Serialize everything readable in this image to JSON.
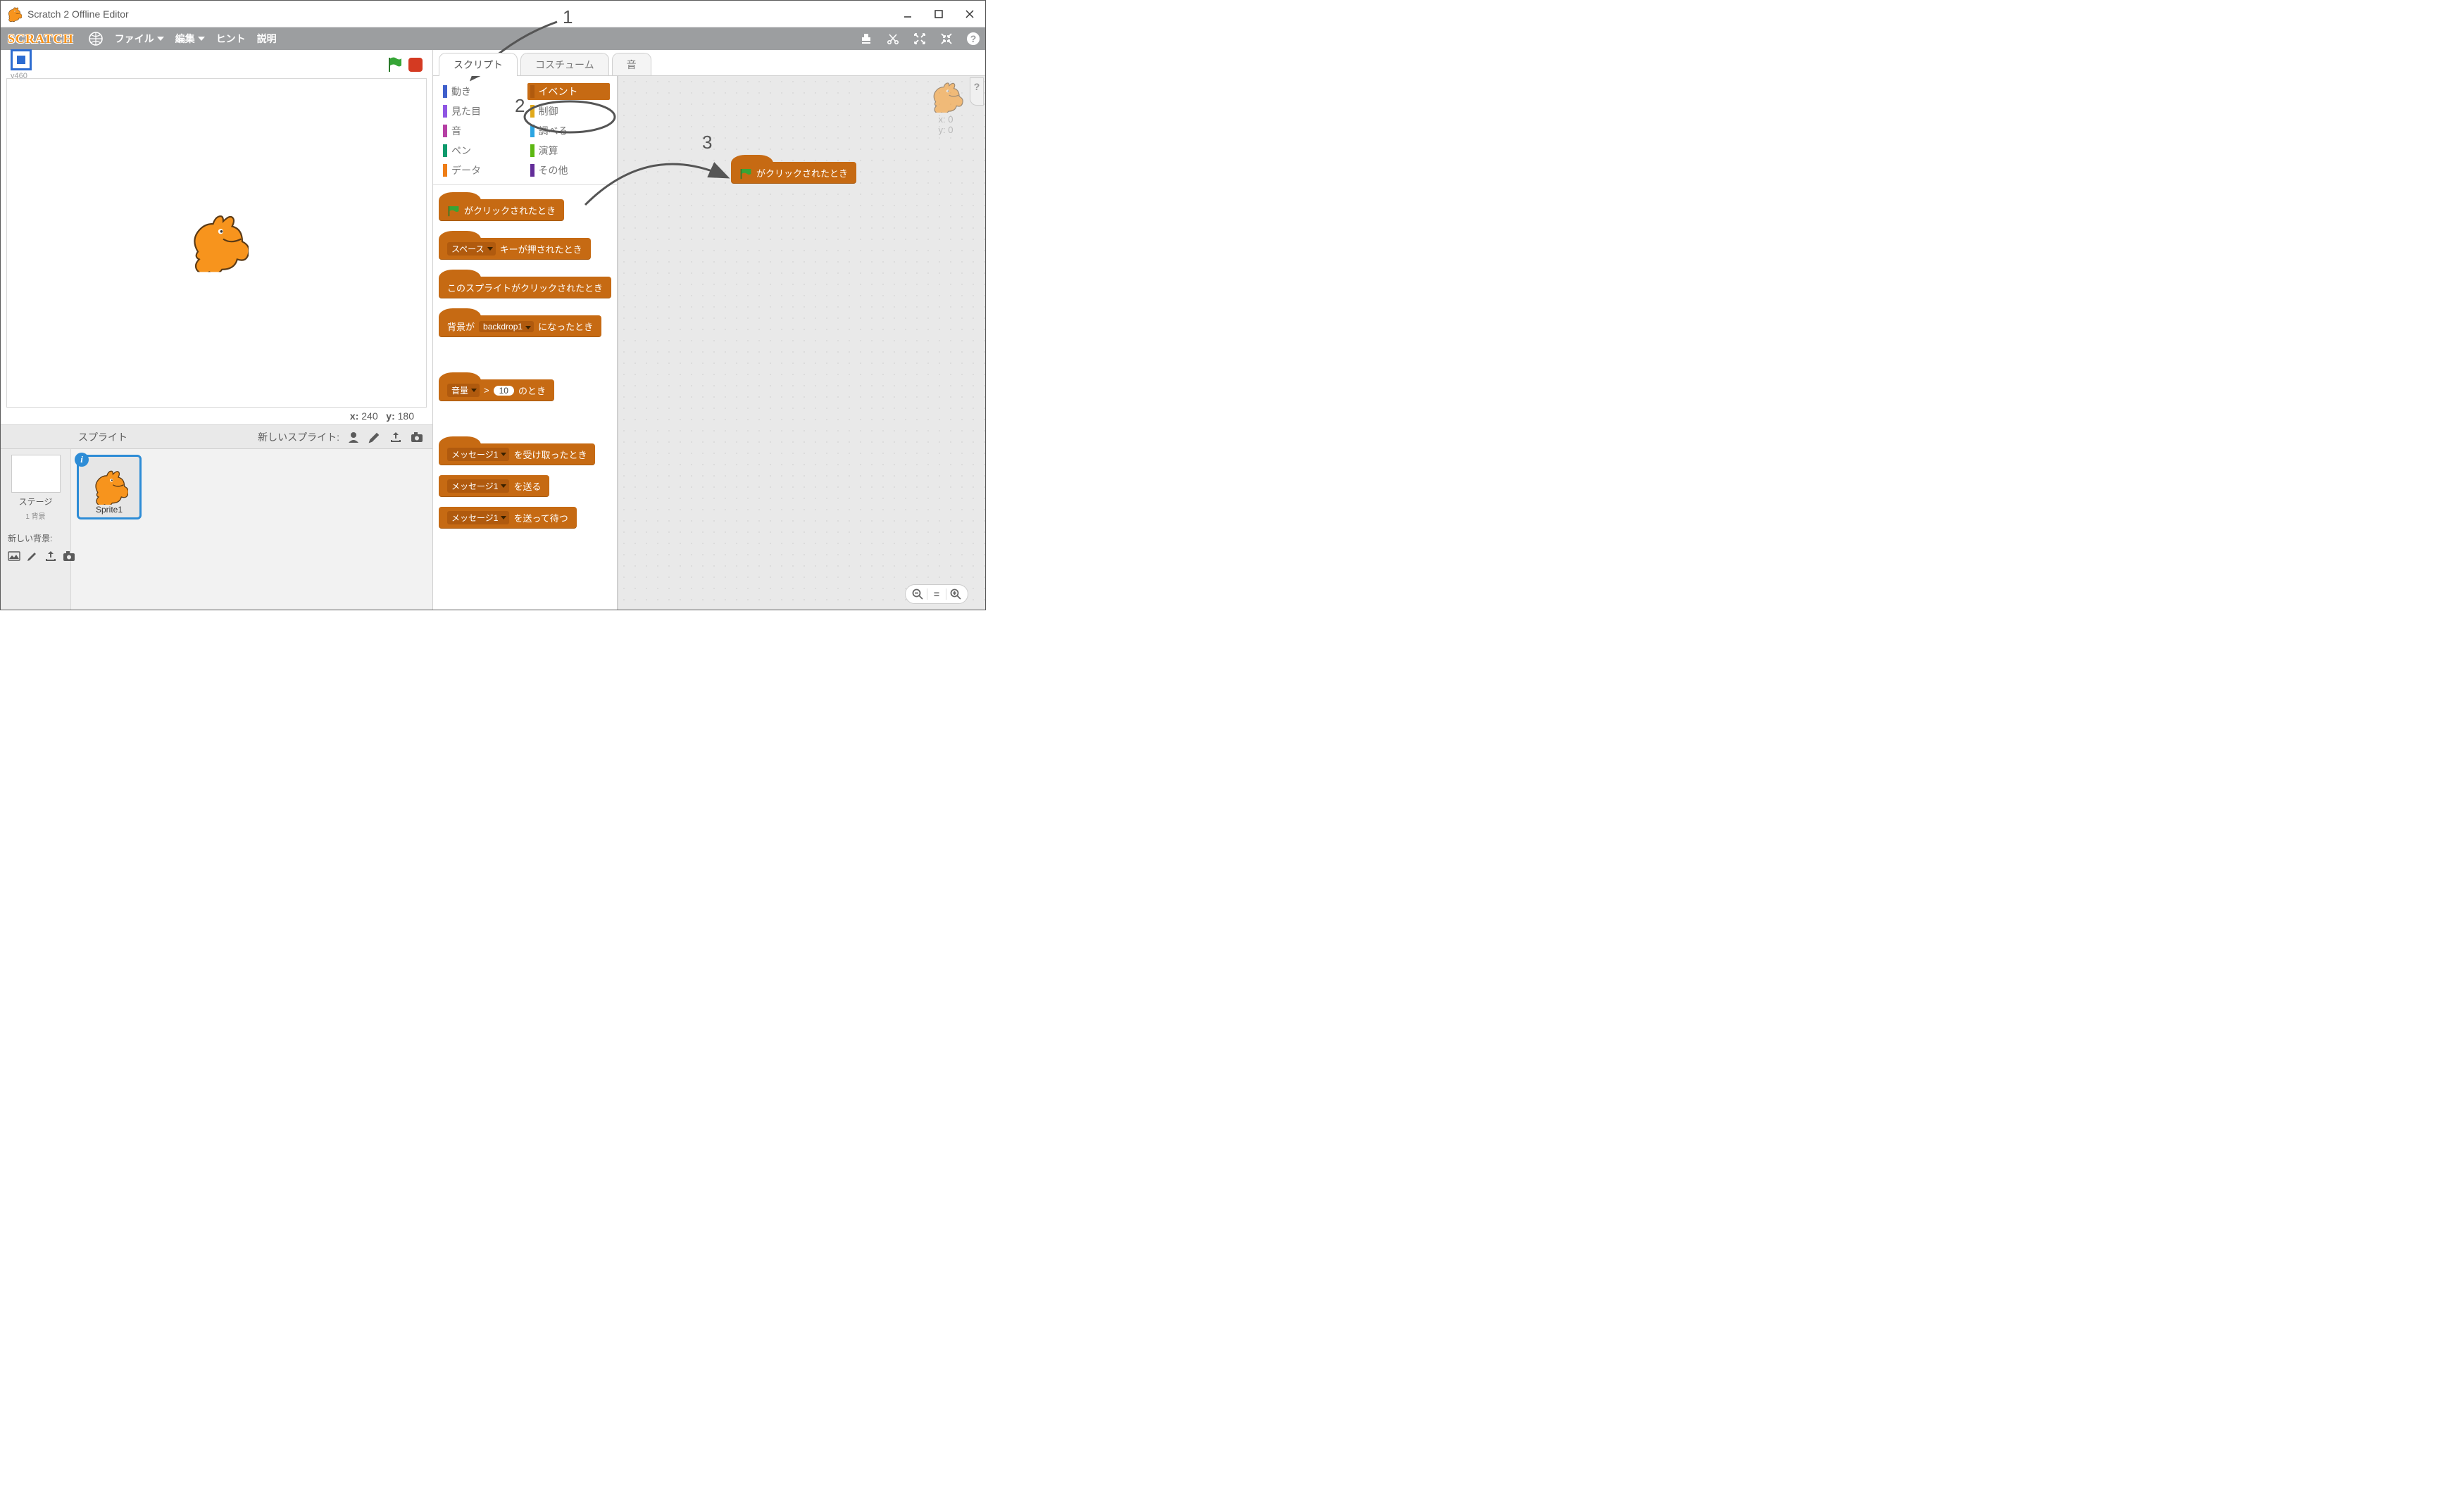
{
  "window": {
    "title": "Scratch 2 Offline Editor",
    "controls": {
      "minimize": "—",
      "maximize": "▢",
      "close": "✕"
    }
  },
  "menubar": {
    "logo": "SCRATCH",
    "items": {
      "file": "ファイル",
      "edit": "編集",
      "hints": "ヒント",
      "about": "説明"
    }
  },
  "stage": {
    "version": "v460",
    "coords_x_label": "x:",
    "coords_x": "240",
    "coords_y_label": "y:",
    "coords_y": "180"
  },
  "sprites_panel": {
    "header_label": "スプライト",
    "new_sprite_label": "新しいスプライト:"
  },
  "stage_thumb": {
    "label": "ステージ",
    "sub": "1 背景",
    "new_bg_label": "新しい背景:"
  },
  "sprite": {
    "name": "Sprite1",
    "info": "i"
  },
  "tabs": {
    "scripts": "スクリプト",
    "costumes": "コスチューム",
    "sounds": "音"
  },
  "categories": {
    "motion": {
      "label": "動き",
      "color": "#3f5fcb"
    },
    "looks": {
      "label": "見た目",
      "color": "#8f56e3"
    },
    "sound": {
      "label": "音",
      "color": "#b53fa4"
    },
    "pen": {
      "label": "ペン",
      "color": "#0e9a6c"
    },
    "data": {
      "label": "データ",
      "color": "#ee7d16"
    },
    "events": {
      "label": "イベント",
      "color": "#c66a13"
    },
    "control": {
      "label": "制御",
      "color": "#e1a91a"
    },
    "sensing": {
      "label": "調べる",
      "color": "#2ca5e2"
    },
    "operators": {
      "label": "演算",
      "color": "#5cb712"
    },
    "more": {
      "label": "その他",
      "color": "#632d99"
    }
  },
  "event_blocks": {
    "when_flag": "がクリックされたとき",
    "when_key_prefix_dd": "スペース",
    "when_key_suffix": "キーが押されたとき",
    "when_sprite_clicked": "このスプライトがクリックされたとき",
    "when_backdrop_prefix": "背景が",
    "when_backdrop_dd": "backdrop1",
    "when_backdrop_suffix": "になったとき",
    "when_loud_prefix_dd": "音量",
    "when_loud_gt": ">",
    "when_loud_num": "10",
    "when_loud_suffix": "のとき",
    "when_receive_dd": "メッセージ1",
    "when_receive_suffix": "を受け取ったとき",
    "broadcast_dd": "メッセージ1",
    "broadcast_suffix": "を送る",
    "broadcast_wait_dd": "メッセージ1",
    "broadcast_wait_suffix": "を送って待つ"
  },
  "script_area": {
    "x_label": "x:",
    "x_val": "0",
    "y_label": "y:",
    "y_val": "0",
    "help": "?"
  },
  "zoom": {
    "out_icon": "−",
    "eq_icon": "=",
    "in_icon": "+"
  },
  "annotations": {
    "n1": "1",
    "n2": "2",
    "n3": "3"
  }
}
